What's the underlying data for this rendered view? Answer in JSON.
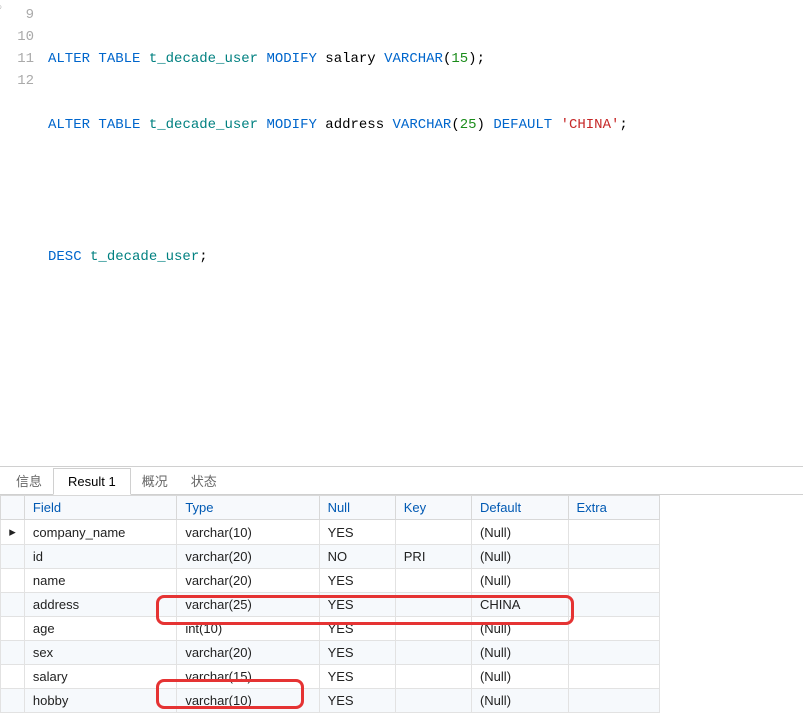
{
  "code": {
    "lines": [
      "9",
      "10",
      "11",
      "12"
    ],
    "l9": {
      "alter": "ALTER",
      "table": "TABLE",
      "tbl": "t_decade_user",
      "modify": "MODIFY",
      "col": "salary",
      "type": "VARCHAR",
      "num": "15",
      "tail": ";"
    },
    "l10": {
      "alter": "ALTER",
      "table": "TABLE",
      "tbl": "t_decade_user",
      "modify": "MODIFY",
      "col": "address",
      "type": "VARCHAR",
      "num": "25",
      "default": "DEFAULT",
      "str": "'CHINA'",
      "tail": ";"
    },
    "l12": {
      "desc": "DESC",
      "tbl": "t_decade_user",
      "tail": ";"
    }
  },
  "tabs": {
    "t0": "信息",
    "t1": "Result 1",
    "t2": "概况",
    "t3": "状态"
  },
  "headers": {
    "field": "Field",
    "type": "Type",
    "null": "Null",
    "key": "Key",
    "default": "Default",
    "extra": "Extra"
  },
  "chart_data": {
    "type": "table",
    "columns": [
      "Field",
      "Type",
      "Null",
      "Key",
      "Default",
      "Extra"
    ],
    "rows": [
      {
        "Field": "company_name",
        "Type": "varchar(10)",
        "Null": "YES",
        "Key": "",
        "Default": "(Null)",
        "Extra": ""
      },
      {
        "Field": "id",
        "Type": "varchar(20)",
        "Null": "NO",
        "Key": "PRI",
        "Default": "(Null)",
        "Extra": ""
      },
      {
        "Field": "name",
        "Type": "varchar(20)",
        "Null": "YES",
        "Key": "",
        "Default": "(Null)",
        "Extra": ""
      },
      {
        "Field": "address",
        "Type": "varchar(25)",
        "Null": "YES",
        "Key": "",
        "Default": "CHINA",
        "Extra": ""
      },
      {
        "Field": "age",
        "Type": "int(10)",
        "Null": "YES",
        "Key": "",
        "Default": "(Null)",
        "Extra": ""
      },
      {
        "Field": "sex",
        "Type": "varchar(20)",
        "Null": "YES",
        "Key": "",
        "Default": "(Null)",
        "Extra": ""
      },
      {
        "Field": "salary",
        "Type": "varchar(15)",
        "Null": "YES",
        "Key": "",
        "Default": "(Null)",
        "Extra": ""
      },
      {
        "Field": "hobby",
        "Type": "varchar(10)",
        "Null": "YES",
        "Key": "",
        "Default": "(Null)",
        "Extra": ""
      }
    ]
  },
  "rows": {
    "r0": {
      "field": "company_name",
      "type": "varchar(10)",
      "null": "YES",
      "key": "",
      "default": "(Null)",
      "defnull": true,
      "extra": ""
    },
    "r1": {
      "field": "id",
      "type": "varchar(20)",
      "null": "NO",
      "key": "PRI",
      "default": "(Null)",
      "defnull": true,
      "extra": ""
    },
    "r2": {
      "field": "name",
      "type": "varchar(20)",
      "null": "YES",
      "key": "",
      "default": "(Null)",
      "defnull": true,
      "extra": ""
    },
    "r3": {
      "field": "address",
      "type": "varchar(25)",
      "null": "YES",
      "key": "",
      "default": "CHINA",
      "defnull": false,
      "extra": ""
    },
    "r4": {
      "field": "age",
      "type": "int(10)",
      "null": "YES",
      "key": "",
      "default": "(Null)",
      "defnull": true,
      "extra": ""
    },
    "r5": {
      "field": "sex",
      "type": "varchar(20)",
      "null": "YES",
      "key": "",
      "default": "(Null)",
      "defnull": true,
      "extra": ""
    },
    "r6": {
      "field": "salary",
      "type": "varchar(15)",
      "null": "YES",
      "key": "",
      "default": "(Null)",
      "defnull": true,
      "extra": ""
    },
    "r7": {
      "field": "hobby",
      "type": "varchar(10)",
      "null": "YES",
      "key": "",
      "default": "(Null)",
      "defnull": true,
      "extra": ""
    }
  },
  "arrow": "▸"
}
